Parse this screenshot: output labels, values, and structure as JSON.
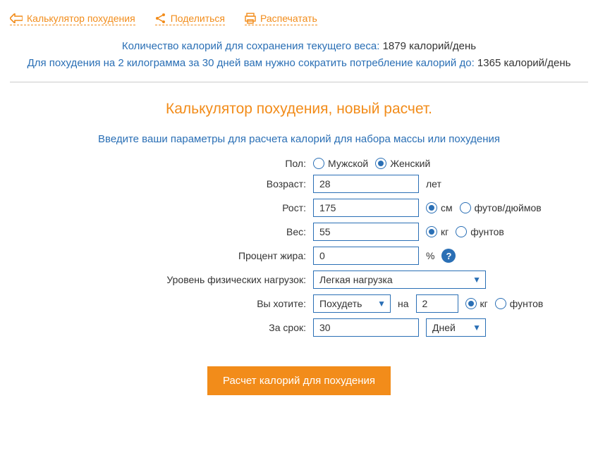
{
  "nav": {
    "back": "Калькулятор похудения",
    "share": "Поделиться",
    "print": "Распечатать"
  },
  "summary": {
    "maintain_label": "Количество калорий для сохранения текущего веса:",
    "maintain_value": "1879 калорий/день",
    "reduce_label": "Для похудения на 2 килограмма за 30 дней вам нужно сократить потребление калорий до:",
    "reduce_value": "1365 калорий/день"
  },
  "calc_title": "Калькулятор похудения, новый расчет.",
  "instruction": "Введите ваши параметры для расчета калорий для набора массы или похудения",
  "form": {
    "gender_label": "Пол:",
    "gender_male": "Мужской",
    "gender_female": "Женский",
    "age_label": "Возраст:",
    "age_value": "28",
    "age_unit": "лет",
    "height_label": "Рост:",
    "height_value": "175",
    "height_unit_cm": "см",
    "height_unit_ft": "футов/дюймов",
    "weight_label": "Вес:",
    "weight_value": "55",
    "weight_unit_kg": "кг",
    "weight_unit_lb": "фунтов",
    "fat_label": "Процент жира:",
    "fat_value": "0",
    "fat_unit": "%",
    "activity_label": "Уровень физических нагрузок:",
    "activity_value": "Легкая нагрузка",
    "goal_label": "Вы хотите:",
    "goal_value": "Похудеть",
    "goal_by": "на",
    "goal_amount": "2",
    "goal_unit_kg": "кг",
    "goal_unit_lb": "фунтов",
    "term_label": "За срок:",
    "term_value": "30",
    "term_unit": "Дней"
  },
  "submit": "Расчет калорий для похудения"
}
